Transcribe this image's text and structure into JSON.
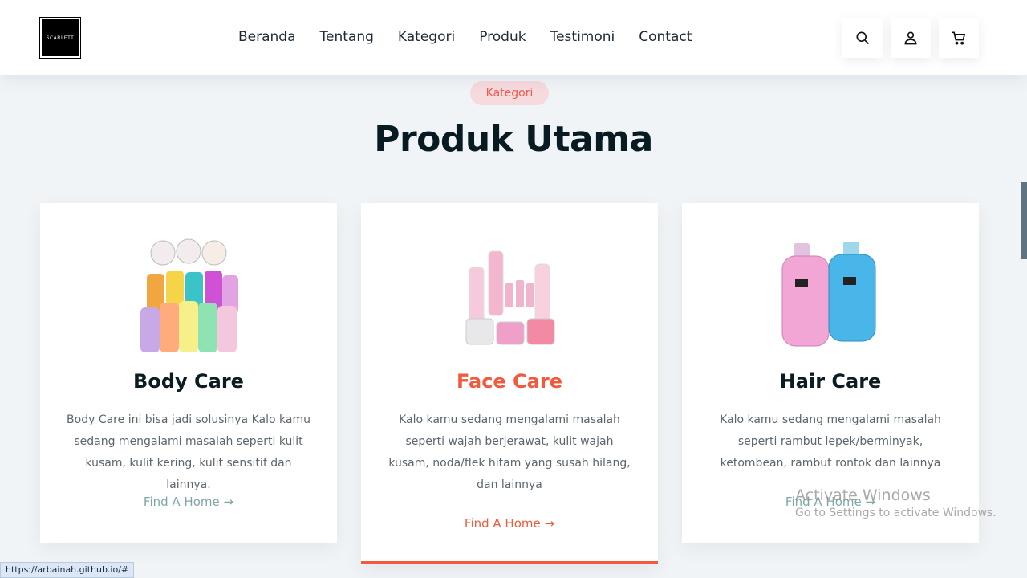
{
  "header": {
    "logo_text": "SCARLETT",
    "nav": [
      "Beranda",
      "Tentang",
      "Kategori",
      "Produk",
      "Testimoni",
      "Contact"
    ],
    "icons": [
      "search-icon",
      "user-icon",
      "cart-icon"
    ]
  },
  "section": {
    "pill": "Kategori",
    "title": "Produk Utama"
  },
  "cards": [
    {
      "name": "Body Care",
      "desc": "Body Care ini bisa jadi solusinya Kalo kamu sedang mengalami masalah seperti kulit kusam, kulit kering, kulit sensitif dan lainnya.",
      "link": "Find A Home →"
    },
    {
      "name": "Face Care",
      "desc": "Kalo kamu sedang mengalami masalah seperti wajah berjerawat, kulit wajah kusam, noda/flek hitam yang susah hilang, dan lainnya",
      "link": "Find A Home →"
    },
    {
      "name": "Hair Care",
      "desc": "Kalo kamu sedang mengalami masalah seperti rambut lepek/berminyak, ketombean, rambut rontok dan lainnya",
      "link": "Find A Home →"
    }
  ],
  "colors": {
    "accent": "#f05a3f",
    "pill_bg": "#f6dadd",
    "link_muted": "#7fa7a8",
    "page_bg": "#f1f4f6"
  },
  "status_bar": {
    "url": "https://arbainah.github.io/#"
  },
  "watermark": {
    "title": "Activate Windows",
    "subtitle": "Go to Settings to activate Windows."
  }
}
